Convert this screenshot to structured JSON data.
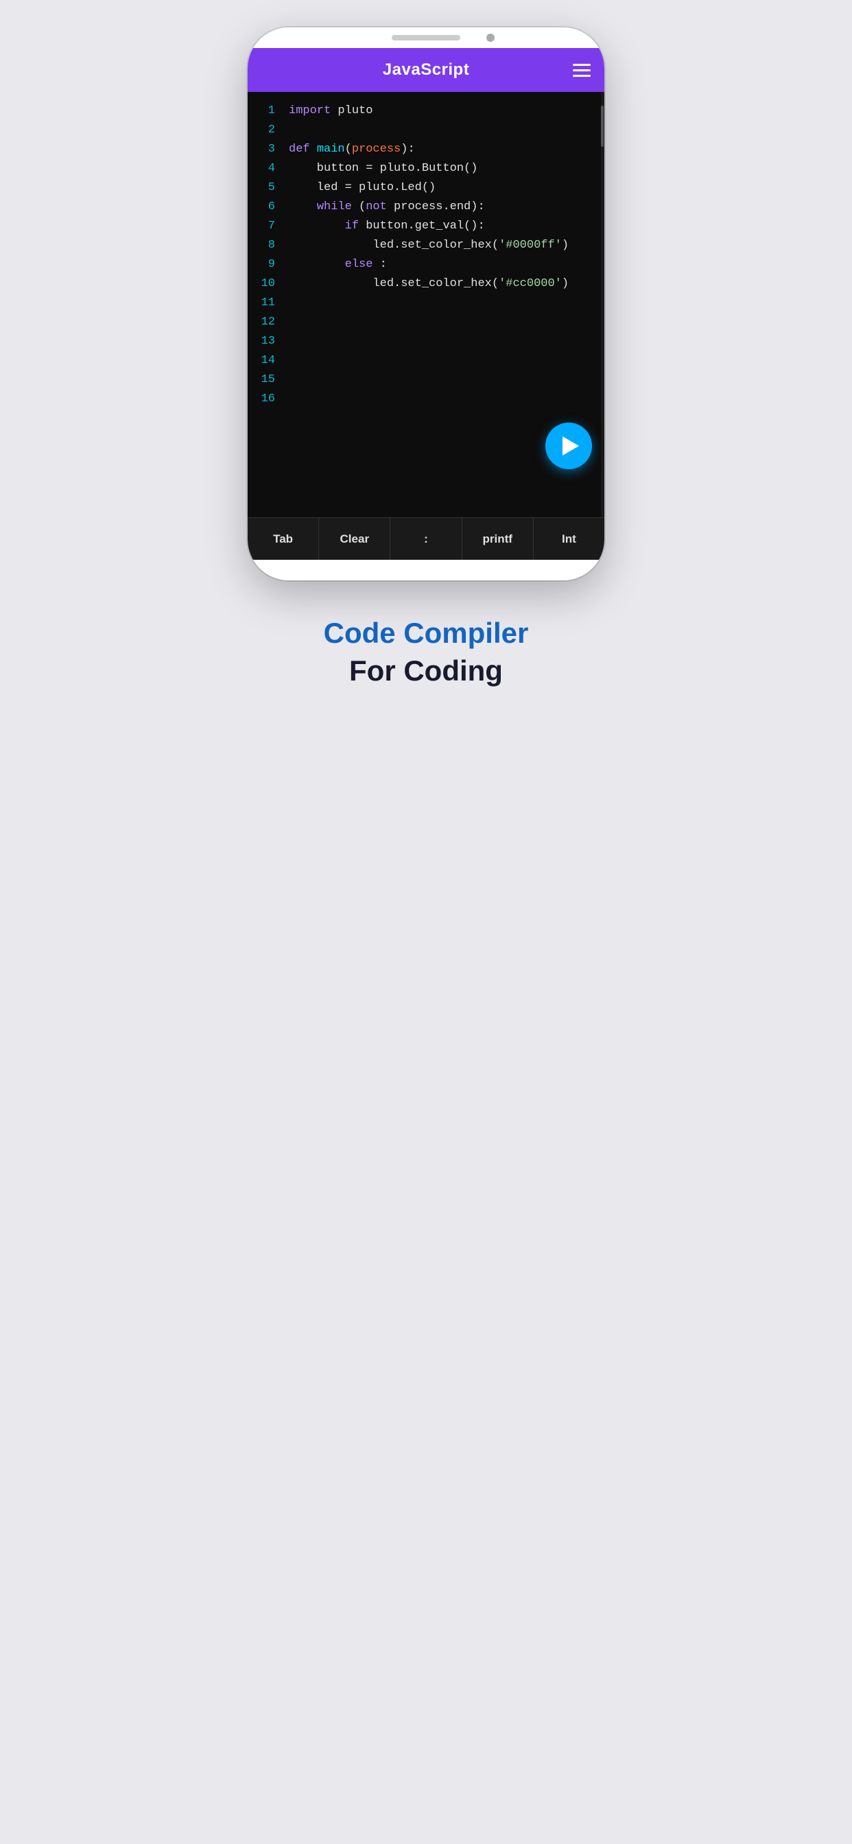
{
  "app": {
    "title": "JavaScript",
    "header_color": "#7c3aed"
  },
  "code": {
    "lines": [
      {
        "num": "1",
        "content": [
          {
            "text": "import",
            "class": "kw-import"
          },
          {
            "text": " pluto",
            "class": "kw-plain"
          }
        ]
      },
      {
        "num": "2",
        "content": []
      },
      {
        "num": "3",
        "content": [
          {
            "text": "def",
            "class": "kw-def"
          },
          {
            "text": " ",
            "class": "kw-plain"
          },
          {
            "text": "main",
            "class": "kw-func"
          },
          {
            "text": "(",
            "class": "kw-plain"
          },
          {
            "text": "process",
            "class": "kw-param"
          },
          {
            "text": "):",
            "class": "kw-plain"
          }
        ]
      },
      {
        "num": "4",
        "content": [
          {
            "text": "    button = pluto.Button()",
            "class": "kw-plain"
          }
        ]
      },
      {
        "num": "5",
        "content": [
          {
            "text": "    led = pluto.Led()",
            "class": "kw-plain"
          }
        ]
      },
      {
        "num": "6",
        "content": [
          {
            "text": "    ",
            "class": "kw-plain"
          },
          {
            "text": "while",
            "class": "kw-while"
          },
          {
            "text": " (",
            "class": "kw-plain"
          },
          {
            "text": "not",
            "class": "kw-not"
          },
          {
            "text": " process.end):",
            "class": "kw-plain"
          }
        ]
      },
      {
        "num": "7",
        "content": [
          {
            "text": "        ",
            "class": "kw-plain"
          },
          {
            "text": "if",
            "class": "kw-if"
          },
          {
            "text": " button.get_val():",
            "class": "kw-plain"
          }
        ]
      },
      {
        "num": "8",
        "content": [
          {
            "text": "            led.set_color_hex(",
            "class": "kw-plain"
          },
          {
            "text": "'#0000ff'",
            "class": "kw-string"
          },
          {
            "text": ")",
            "class": "kw-plain"
          }
        ]
      },
      {
        "num": "9",
        "content": [
          {
            "text": "        ",
            "class": "kw-plain"
          },
          {
            "text": "else",
            "class": "kw-else"
          },
          {
            "text": " :",
            "class": "kw-plain"
          }
        ]
      },
      {
        "num": "10",
        "content": [
          {
            "text": "            led.set_color_hex(",
            "class": "kw-plain"
          },
          {
            "text": "'#cc0000'",
            "class": "kw-string"
          },
          {
            "text": ")",
            "class": "kw-plain"
          }
        ]
      },
      {
        "num": "11",
        "content": []
      },
      {
        "num": "12",
        "content": []
      },
      {
        "num": "13",
        "content": []
      },
      {
        "num": "14",
        "content": []
      },
      {
        "num": "15",
        "content": []
      },
      {
        "num": "16",
        "content": []
      }
    ]
  },
  "toolbar": {
    "items": [
      "Tab",
      "Clear",
      ":",
      "printf",
      "Int"
    ]
  },
  "run_button": {
    "label": "Run"
  },
  "caption": {
    "line1": "Code Compiler",
    "line2": "For Coding"
  }
}
